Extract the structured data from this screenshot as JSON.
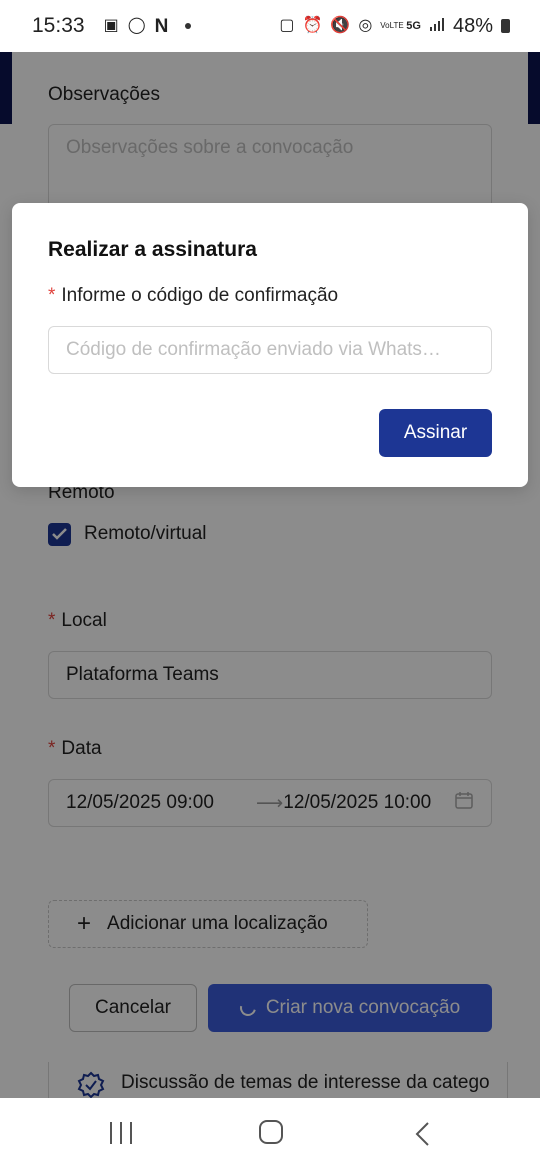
{
  "status_bar": {
    "time": "15:33",
    "network": "5G",
    "lte": "VoLTE",
    "battery": "48%"
  },
  "form": {
    "observations_label": "Observações",
    "observations_placeholder": "Observações sobre a convocação",
    "remote_label": "Remoto",
    "remote_checkbox_label": "Remoto/virtual",
    "remote_checked": true,
    "local_label": "Local",
    "local_value": "Plataforma Teams",
    "date_label": "Data",
    "date_start": "12/05/2025 09:00",
    "date_end": "12/05/2025 10:00",
    "add_location_label": "Adicionar uma localização",
    "cancel_label": "Cancelar",
    "create_label": "Criar nova convocação",
    "agenda_item": "Discussão de temas de interesse da catego"
  },
  "modal": {
    "title": "Realizar a assinatura",
    "code_label": "Informe o código de confirmação",
    "code_placeholder": "Código de confirmação enviado via Whats…",
    "sign_button": "Assinar"
  },
  "colors": {
    "primary": "#1d3694",
    "header_navy": "#0c1550",
    "required": "#e0433d"
  }
}
